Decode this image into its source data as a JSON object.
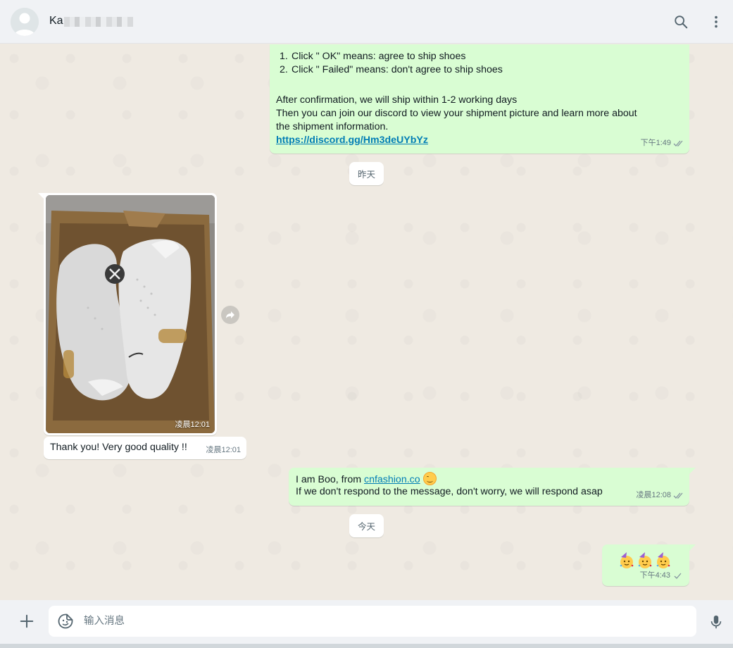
{
  "header": {
    "contact_name_visible": "Ka",
    "icons": {
      "search": "search-icon",
      "menu": "more-vertical-icon",
      "avatar": "default-avatar-icon"
    }
  },
  "messages": {
    "shipping": {
      "list": [
        {
          "num": "1.",
          "text": "Click \" OK\" means: agree to ship shoes"
        },
        {
          "num": "2.",
          "text": "Click \" Failed\" means: don't agree to ship shoes"
        }
      ],
      "line1": "After confirmation, we will ship within 1-2 working days",
      "line2": "Then you can join our discord to view your shipment picture and learn more about",
      "line3": "the shipment information.",
      "link": "https://discord.gg/Hm3deUYbYz",
      "time": "下午1:49",
      "status": "read"
    },
    "date_yesterday": "昨天",
    "photo": {
      "time": "凌晨12:01",
      "alt_icon": "shoe-box-photo"
    },
    "thanks": {
      "text": "Thank you! Very good quality !!",
      "time": "凌晨12:01"
    },
    "intro": {
      "prefix": "I am Boo, from ",
      "link": "cnfashion.co",
      "line2": "If we don't respond to the message, don't worry, we will respond asap",
      "time": "凌晨12:08",
      "status": "read"
    },
    "date_today": "今天",
    "party": {
      "emoji": "🥳🥳🥳",
      "time": "下午4:43",
      "status": "sent"
    }
  },
  "composer": {
    "placeholder": "输入消息",
    "icons": {
      "attach": "plus-icon",
      "sticker": "sticker-icon",
      "mic": "microphone-icon"
    }
  },
  "colors": {
    "outgoing": "#d9fdd3",
    "incoming": "#ffffff",
    "link": "#027eb5",
    "background": "#efeae2"
  }
}
